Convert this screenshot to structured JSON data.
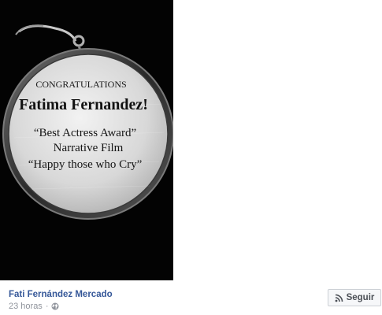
{
  "medal": {
    "line1": "CONGRATULATIONS",
    "line2": "Fatima Fernandez!",
    "line3": "“Best Actress Award”",
    "line4": "Narrative Film",
    "line5": "“Happy those who Cry”"
  },
  "post": {
    "author": "Fati Fernández Mercado",
    "time": "23 horas",
    "separator": "·",
    "privacy_icon": "globe-icon"
  },
  "follow_button": {
    "label": "Seguir",
    "icon": "rss-icon"
  }
}
